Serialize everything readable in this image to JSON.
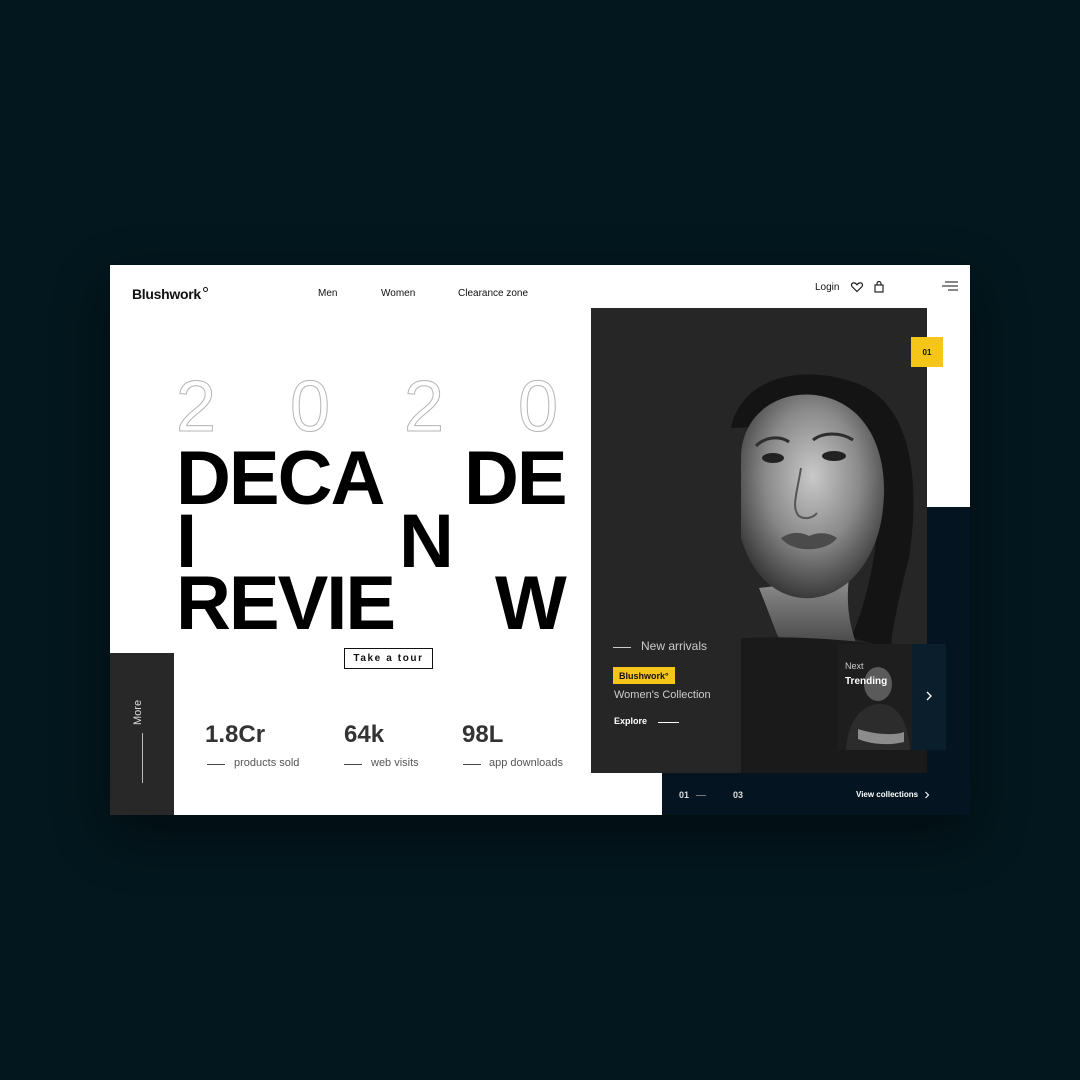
{
  "header": {
    "logo": "Blushwork",
    "nav": [
      "Men",
      "Women",
      "Clearance zone"
    ],
    "login": "Login"
  },
  "hero": {
    "year_digits": [
      "2",
      "0",
      "2",
      "0"
    ],
    "headline_words": [
      "DECA",
      "DE",
      "I",
      "N",
      "REVIE",
      "W"
    ],
    "cta": "Take a tour"
  },
  "sidebar": {
    "more_label": "More"
  },
  "stats": [
    {
      "value": "1.8Cr",
      "label": "products sold"
    },
    {
      "value": "64k",
      "label": "web visits"
    },
    {
      "value": "98L",
      "label": "app downloads"
    }
  ],
  "feature": {
    "slide_badge": "01",
    "kicker": "New arrivals",
    "brand_tag": "Blushwork°",
    "collection": "Women's Collection",
    "explore": "Explore"
  },
  "next_card": {
    "label": "Next",
    "title": "Trending"
  },
  "pager": {
    "current": "01",
    "total": "03",
    "view_collections": "View collections"
  },
  "colors": {
    "accent": "#f5c518",
    "page_bg": "#03171e",
    "panel_dark": "#282828",
    "navy": "#041421"
  },
  "icons": [
    "heart-icon",
    "bag-icon",
    "menu-icon",
    "chevron-right-icon"
  ]
}
